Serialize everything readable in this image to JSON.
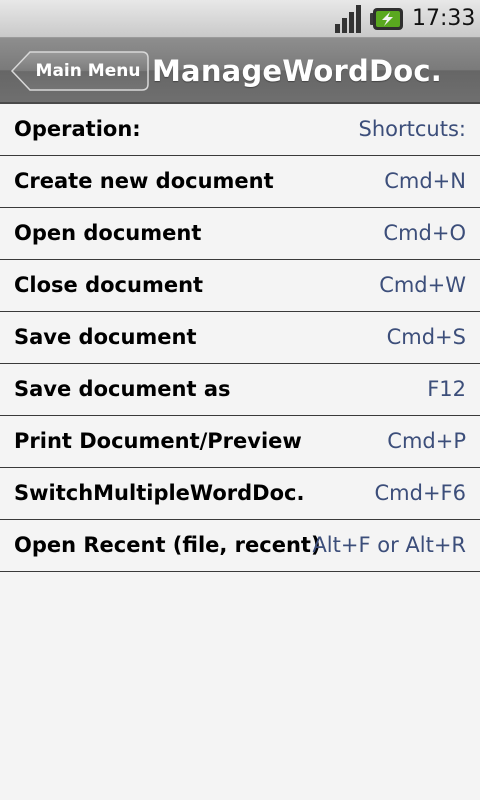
{
  "status_bar": {
    "time": "17:33",
    "icons": [
      "signal-icon",
      "battery-charging-icon"
    ],
    "battery_color": "#5aa81f"
  },
  "title_bar": {
    "back_label": "Main Menu",
    "title": "ManageWordDoc."
  },
  "table": {
    "header": {
      "operation": "Operation:",
      "shortcut": "Shortcuts:"
    },
    "rows": [
      {
        "operation": "Create new document",
        "shortcut": "Cmd+N"
      },
      {
        "operation": "Open document",
        "shortcut": "Cmd+O"
      },
      {
        "operation": "Close document",
        "shortcut": "Cmd+W"
      },
      {
        "operation": "Save document",
        "shortcut": "Cmd+S"
      },
      {
        "operation": "Save document as",
        "shortcut": "F12"
      },
      {
        "operation": "Print Document/Preview",
        "shortcut": "Cmd+P"
      },
      {
        "operation": "SwitchMultipleWordDoc.",
        "shortcut": "Cmd+F6"
      },
      {
        "operation": "Open Recent (file, recent)",
        "shortcut": "Alt+F or Alt+R"
      }
    ]
  },
  "colors": {
    "shortcut_text": "#3c4e7a",
    "background": "#f4f4f4",
    "title_bar": "#7a7a7a"
  }
}
